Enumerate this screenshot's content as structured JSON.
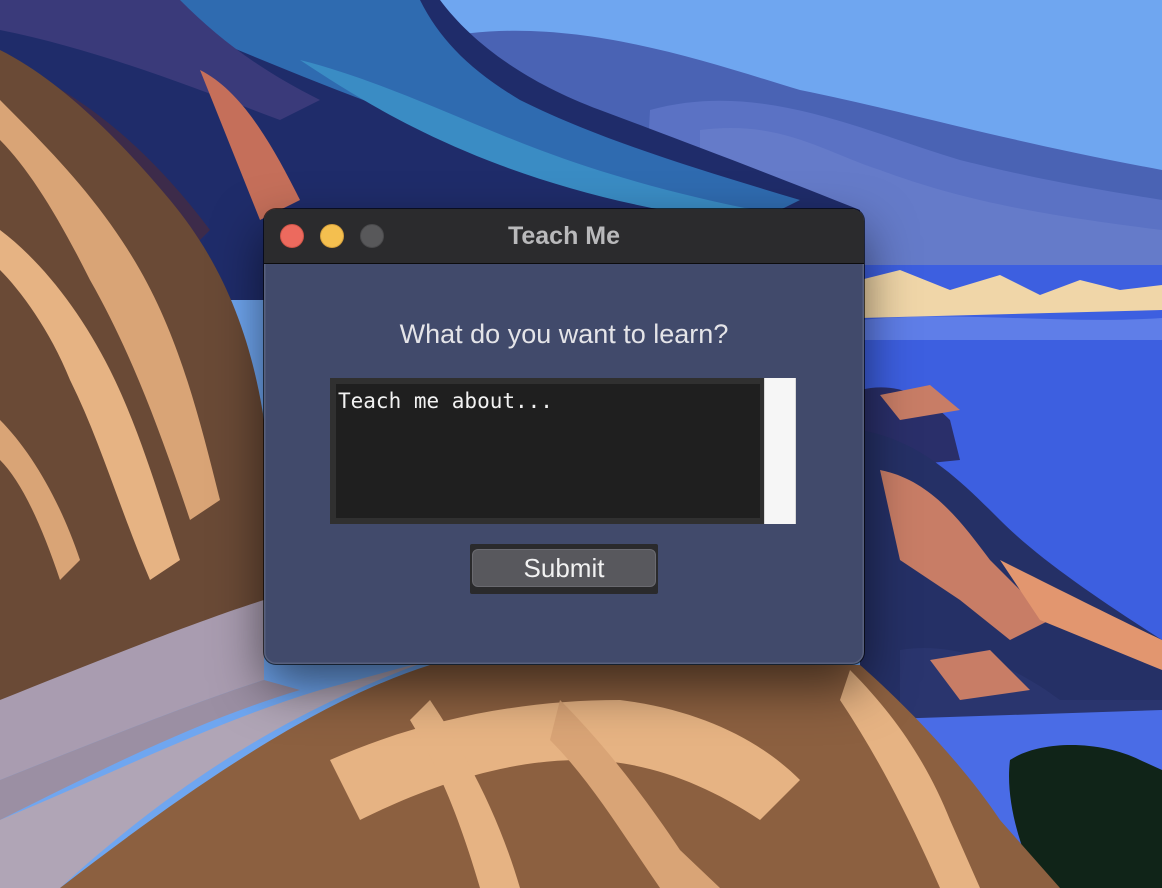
{
  "window": {
    "title": "Teach Me"
  },
  "window_controls": {
    "close": "close-icon",
    "minimize": "minimize-icon",
    "zoom": "zoom-icon"
  },
  "form": {
    "prompt": "What do you want to learn?",
    "input_value": "Teach me about...",
    "submit_label": "Submit"
  },
  "colors": {
    "window_background": "#414a6b",
    "titlebar": "#2b2b2d",
    "close": "#ec6a5e",
    "minimize": "#f4bf4f",
    "zoom_disabled": "#58585a",
    "text_area_background": "#1f1f1f"
  }
}
